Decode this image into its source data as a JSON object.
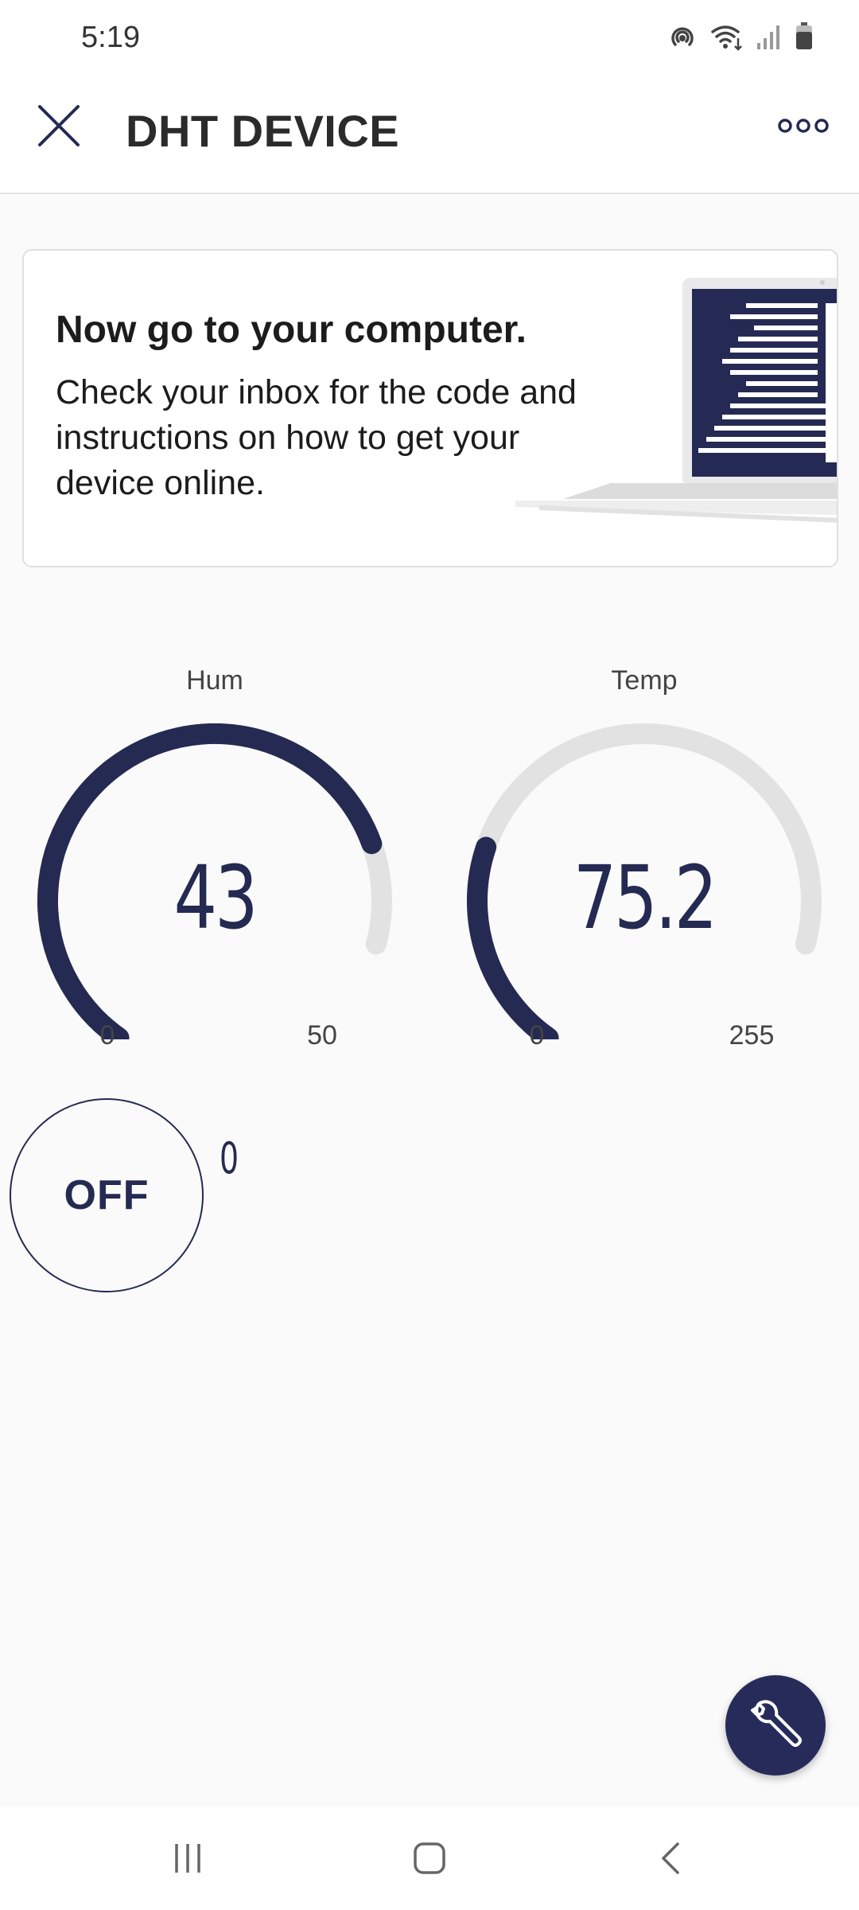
{
  "status_bar": {
    "time": "5:19",
    "icons": [
      "hotspot-icon",
      "wifi-icon",
      "signal-icon",
      "battery-icon"
    ]
  },
  "app_bar": {
    "title": "DHT DEVICE",
    "close_icon": "close-icon",
    "more_icon": "more-horizontal-icon"
  },
  "promo": {
    "title": "Now go to your computer.",
    "body": "Check your inbox for the code and instructions on how to get your device online."
  },
  "gauges": [
    {
      "label": "Hum",
      "value": "43",
      "min": "0",
      "max": "50",
      "fraction": 0.86
    },
    {
      "label": "Temp",
      "value": "75.2",
      "min": "0",
      "max": "255",
      "fraction": 0.295
    }
  ],
  "switch": {
    "label": "OFF",
    "value": "0"
  },
  "colors": {
    "accent": "#242a52",
    "track": "#e2e2e2",
    "fab": "#262b5a"
  }
}
